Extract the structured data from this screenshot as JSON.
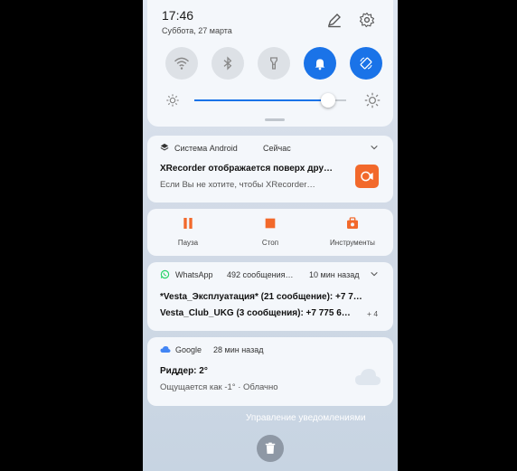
{
  "status": {
    "time": "17:46",
    "date": "Суббота, 27 марта"
  },
  "quick_settings": {
    "tiles": [
      {
        "name": "wifi",
        "active": false
      },
      {
        "name": "bluetooth",
        "active": false
      },
      {
        "name": "flashlight",
        "active": false
      },
      {
        "name": "sound",
        "active": true
      },
      {
        "name": "auto-rotate",
        "active": true
      }
    ],
    "brightness": 0.88,
    "accent": "#1a73e8"
  },
  "notifications": {
    "android_system": {
      "app": "Система Android",
      "when": "Сейчас",
      "title": "XRecorder отображается поверх дру…",
      "text": "Если Вы не хотите, чтобы XRecorder…",
      "icon_color": "#f2692b"
    },
    "recorder_controls": {
      "pause": "Пауза",
      "stop": "Стоп",
      "tools": "Инструменты",
      "color": "#f2692b"
    },
    "whatsapp": {
      "app": "WhatsApp",
      "summary": "492 сообщения…",
      "when": "10 мин назад",
      "line1": "*Vesta_Эксплуатация* (21 сообщение): +7 7…",
      "line2": "Vesta_Club_UKG (3 сообщения): +7 775 6…",
      "more": "+ 4",
      "color": "#25d366"
    },
    "google": {
      "app": "Google",
      "when": "28 мин назад",
      "title": "Риддер: 2°",
      "text": "Ощущается как -1° · Облачно",
      "color": "#4285f4"
    }
  },
  "footer": {
    "manage": "Управление уведомлениями"
  }
}
